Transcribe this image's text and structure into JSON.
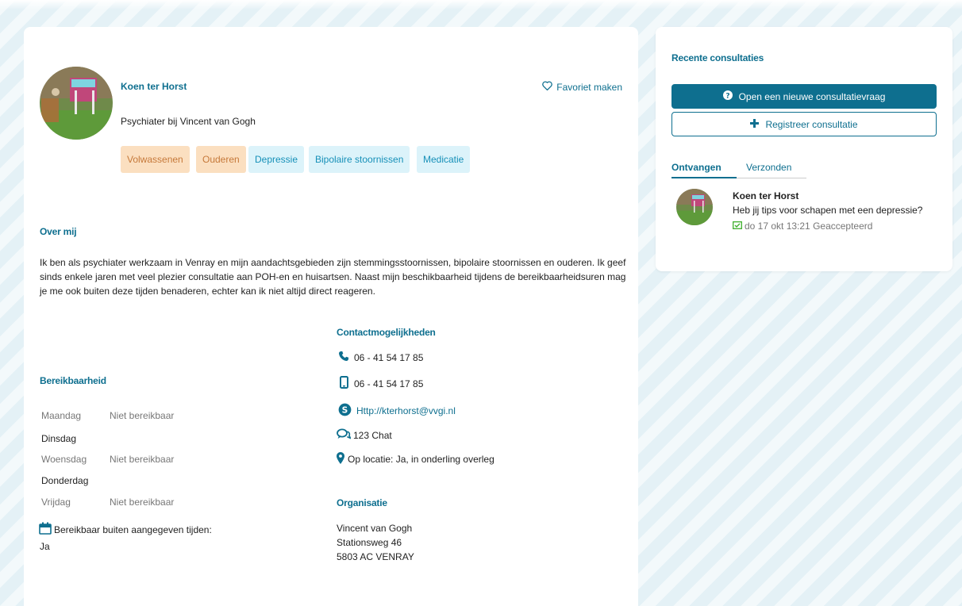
{
  "profile": {
    "name": "Koen ter Horst",
    "role": "Psychiater bij Vincent van Gogh",
    "favorite_label": "Favoriet maken",
    "tags": [
      {
        "label": "Volwassenen",
        "style": "orange"
      },
      {
        "label": "Ouderen",
        "style": "orange"
      },
      {
        "label": "Depressie",
        "style": "blue"
      },
      {
        "label": "Bipolaire stoornissen",
        "style": "blue"
      },
      {
        "label": "Medicatie",
        "style": "blue"
      }
    ]
  },
  "about": {
    "heading": "Over mij",
    "text": "Ik ben als psychiater werkzaam in Venray en mijn aandachtsgebieden zijn stemmingsstoornissen, bipolaire stoornissen en ouderen. Ik geef sinds enkele jaren met veel plezier consultatie aan POH-en en huisartsen. Naast mijn beschikbaarheid tijdens de bereikbaarheidsuren mag je me ook buiten deze tijden benaderen, echter kan ik niet altijd direct reageren."
  },
  "availability": {
    "heading": "Bereikbaarheid",
    "days": [
      {
        "day": "Maandag",
        "value": "Niet bereikbaar"
      },
      {
        "day": "Dinsdag",
        "value": ""
      },
      {
        "day": "Woensdag",
        "value": "Niet bereikbaar"
      },
      {
        "day": "Donderdag",
        "value": ""
      },
      {
        "day": "Vrijdag",
        "value": "Niet bereikbaar"
      }
    ],
    "outside_label": "Bereikbaar buiten aangegeven tijden:",
    "outside_value": "Ja"
  },
  "contact": {
    "heading": "Contactmogelijkheden",
    "phone": "06 - 41 54 17 85",
    "mobile": "06 - 41 54 17 85",
    "skype": "Http://kterhorst@vvgi.nl",
    "chat": "123 Chat",
    "location": "Op locatie: Ja, in onderling overleg"
  },
  "organisation": {
    "heading": "Organisatie",
    "name": "Vincent van Gogh",
    "street": "Stationsweg 46",
    "city": "5803 AC VENRAY"
  },
  "sidebar": {
    "heading": "Recente consultaties",
    "new_button": "Open een nieuwe consultatievraag",
    "register_button": "Registreer consultatie",
    "tabs": [
      "Ontvangen",
      "Verzonden"
    ],
    "item": {
      "name": "Koen ter Horst",
      "message": "Heb jij tips voor schapen met een depressie?",
      "meta": "do 17 okt 13:21 Geaccepteerd"
    }
  },
  "colors": {
    "accent": "#0e6f8f",
    "success": "#3dae2b",
    "tag_orange_bg": "#fbdfc0",
    "tag_blue_bg": "#dcf3fa"
  },
  "icons": [
    "heart-outline-icon",
    "phone-icon",
    "mobile-icon",
    "skype-icon",
    "chat-icon",
    "map-pin-icon",
    "calendar-icon",
    "question-circle-icon",
    "plus-icon",
    "envelope-check-icon"
  ]
}
